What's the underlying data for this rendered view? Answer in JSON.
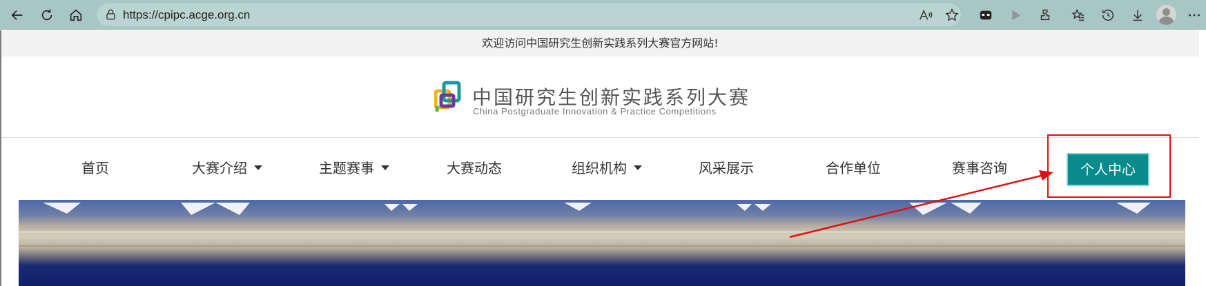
{
  "browser": {
    "url": "https://cpipc.acge.org.cn",
    "icons": {
      "back": "back-arrow-icon",
      "refresh": "refresh-icon",
      "home": "home-icon",
      "lock": "lock-icon",
      "read_aloud": "read-aloud-icon",
      "favorite": "star-icon",
      "extension1": "extension-icon",
      "media": "play-icon",
      "extensions": "puzzle-icon",
      "favorites": "favorites-icon",
      "history": "history-icon",
      "downloads": "download-icon",
      "profile": "profile-avatar-icon",
      "more": "more-icon"
    }
  },
  "site": {
    "welcome": "欢迎访问中国研究生创新实践系列大赛官方网站!",
    "logo_cn": "中国研究生创新实践系列大赛",
    "logo_en": "China Postgraduate Innovation & Practice Competitions",
    "nav": [
      {
        "label": "首页",
        "has_dropdown": false
      },
      {
        "label": "大赛介绍",
        "has_dropdown": true
      },
      {
        "label": "主题赛事",
        "has_dropdown": true
      },
      {
        "label": "大赛动态",
        "has_dropdown": false
      },
      {
        "label": "组织机构",
        "has_dropdown": true
      },
      {
        "label": "风采展示",
        "has_dropdown": false
      },
      {
        "label": "合作单位",
        "has_dropdown": false
      },
      {
        "label": "赛事咨询",
        "has_dropdown": false
      }
    ],
    "personal_center": "个人中心"
  },
  "colors": {
    "accent": "#0a8b8b",
    "annotation": "#e01010",
    "browser_bar": "#a8c6c3"
  }
}
